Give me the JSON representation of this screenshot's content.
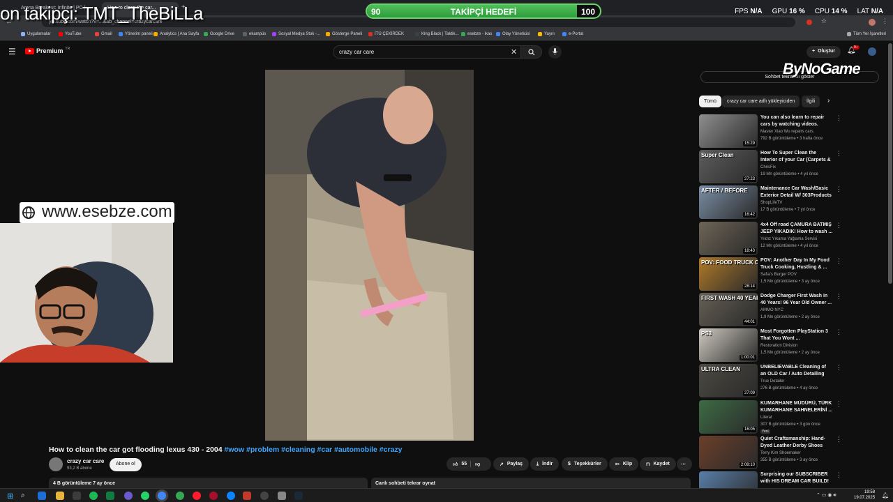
{
  "overlay": {
    "follow_text": "on takipçi: TMT_TheBiLLa",
    "goal_label": "TAKİPÇİ HEDEFİ",
    "goal_current": "90",
    "goal_target": "100",
    "goal_progress": 0.9,
    "stats": {
      "fps_label": "FPS",
      "fps_value": "N/A",
      "gpu_label": "GPU",
      "gpu_value": "16 %",
      "cpu_label": "CPU",
      "cpu_value": "14 %",
      "lat_label": "LAT",
      "lat_value": "N/A"
    },
    "website": "www.esebze.com",
    "brand": "ByNoGame"
  },
  "browser": {
    "tabs": [
      "Arena Breakout: Infinite | PC | ...",
      "How to clean the car..."
    ],
    "url": "youtube.com/watch?v=...&ab_channel=crazycarcare",
    "bookmarks": [
      {
        "label": "Uygulamalar",
        "color": "#8ab4f8"
      },
      {
        "label": "YouTube",
        "color": "#ff0000"
      },
      {
        "label": "Gmail",
        "color": "#ea4335"
      },
      {
        "label": "Yönetim paneli",
        "color": "#4285f4"
      },
      {
        "label": "Analytics | Ana Sayfa",
        "color": "#f9ab00"
      },
      {
        "label": "Google Drive",
        "color": "#34a853"
      },
      {
        "label": "ekampüs",
        "color": "#5f6368"
      },
      {
        "label": "Sosyal Medya Stok -...",
        "color": "#a142f4"
      },
      {
        "label": "Gösterge Paneli",
        "color": "#f9ab00"
      },
      {
        "label": "İTÜ ÇEKİRDEK",
        "color": "#d93025"
      },
      {
        "label": "King Black | Taktik...",
        "color": "#3c4043"
      },
      {
        "label": "esebze - ikas",
        "color": "#34a853"
      },
      {
        "label": "Olay Yöneticisi",
        "color": "#4285f4"
      },
      {
        "label": "Yayın",
        "color": "#fbbc04"
      },
      {
        "label": "e-Portal",
        "color": "#4285f4"
      }
    ],
    "all_bookmarks": "Tüm Yer İşaretleri"
  },
  "youtube": {
    "logo_text": "Premium",
    "logo_sup": "TR",
    "search_value": "crazy car care",
    "create_label": "Oluştur",
    "notif_count": "9+",
    "chat_toggle": "Sohbet tekrarını göster",
    "chips": [
      "Tümü",
      "crazy car care adlı yükleyiciden",
      "İlgili"
    ],
    "video_title": "How to clean the car got flooding lexus 430 - 2004",
    "hashtags": "#wow #problem #cleaning #car #automobile #crazy",
    "channel": "crazy car care",
    "subscribers": "93,2 B abone",
    "subscribe_label": "Abone ol",
    "likes": "55",
    "share": "Paylaş",
    "download": "İndir",
    "thanks": "Teşekkürler",
    "clip": "Klip",
    "save": "Kaydet",
    "views_line": "4 B görüntüleme  7 ay önce",
    "chat_replay": "Canlı sohbeti tekrar oynat",
    "recommendations": [
      {
        "title": "You can also learn to repair cars by watching videos.",
        "channel": "Master Xiao Wu repairs cars.",
        "meta": "792 B görüntüleme • 3 hafta önce",
        "duration": "15:29",
        "color": "#8f8f8f"
      },
      {
        "title": "How To Super Clean the Interior of your Car (Carpets & ...",
        "channel": "ChrisFix",
        "meta": "19 Mn görüntüleme • 4 yıl önce",
        "duration": "27:23",
        "color": "#5d5d5d",
        "overlay": "Super Clean"
      },
      {
        "title": "Maintenance Car Wash/Basic Exterior Detail W/ 303Products",
        "channel": "ShopLifeTV",
        "meta": "17 B görüntüleme • 7 yıl önce",
        "duration": "16:42",
        "color": "#7a8ea5",
        "overlay": "AFTER / BEFORE"
      },
      {
        "title": "4x4 Off road ÇAMURA BATMIŞ JEEP YIKADIK! How to wash ...",
        "channel": "Yıldız Yıkama Yağlama Servisi",
        "meta": "12 Mn görüntüleme • 4 yıl önce",
        "duration": "18:43",
        "color": "#6d6455"
      },
      {
        "title": "POV: Another Day In My Food Truck Cooking, Hustling & ...",
        "channel": "Safia's Burger POV",
        "meta": "1,5 Mn görüntüleme • 3 ay önce",
        "duration": "28:14",
        "color": "#b07a2a",
        "overlay": "POV: FOOD TRUCK COOKING"
      },
      {
        "title": "Dodge Charger First Wash in 40 Years! 96 Year Old Owner ...",
        "channel": "AMMO NYC",
        "meta": "1,9 Mn görüntüleme • 2 ay önce",
        "duration": "44:01",
        "color": "#666055",
        "overlay": "FIRST WASH 40 YEARS"
      },
      {
        "title": "Most Forgotten PlayStation 3 That You Wont ...",
        "channel": "Restoration Division",
        "meta": "1,5 Mn görüntüleme • 2 ay önce",
        "duration": "1:00:01",
        "color": "#cfcac0",
        "overlay": "PS3"
      },
      {
        "title": "UNBELIEVABLE Cleaning of an OLD Car / Auto Detailing ASM...",
        "channel": "True Detailer",
        "meta": "276 B görüntüleme • 4 ay önce",
        "duration": "27:09",
        "color": "#4c4a42",
        "overlay": "ULTRA CLEAN"
      },
      {
        "title": "KUMARHANE MÜDÜRÜ, TÜRK KUMARHANE SAHNELERİNİ ...",
        "channel": "Literat",
        "meta": "307 B görüntüleme • 3 gün önce",
        "duration": "16:05",
        "color": "#3d6b44",
        "badge": "Yeni"
      },
      {
        "title": "Quiet Craftsmanship: Hand-Dyed Leather Derby Shoes",
        "channel": "Terry Kim Shoemaker",
        "meta": "355 B görüntüleme • 3 ay önce",
        "duration": "2:08:10",
        "color": "#6b3f2a"
      },
      {
        "title": "Surprising our SUBSCRIBER with HIS DREAM CAR BUILD! ...",
        "channel": "",
        "meta": "",
        "duration": "",
        "color": "#5a7ea8"
      }
    ]
  },
  "taskbar": {
    "time": "19:58",
    "date": "19.07.2025"
  }
}
